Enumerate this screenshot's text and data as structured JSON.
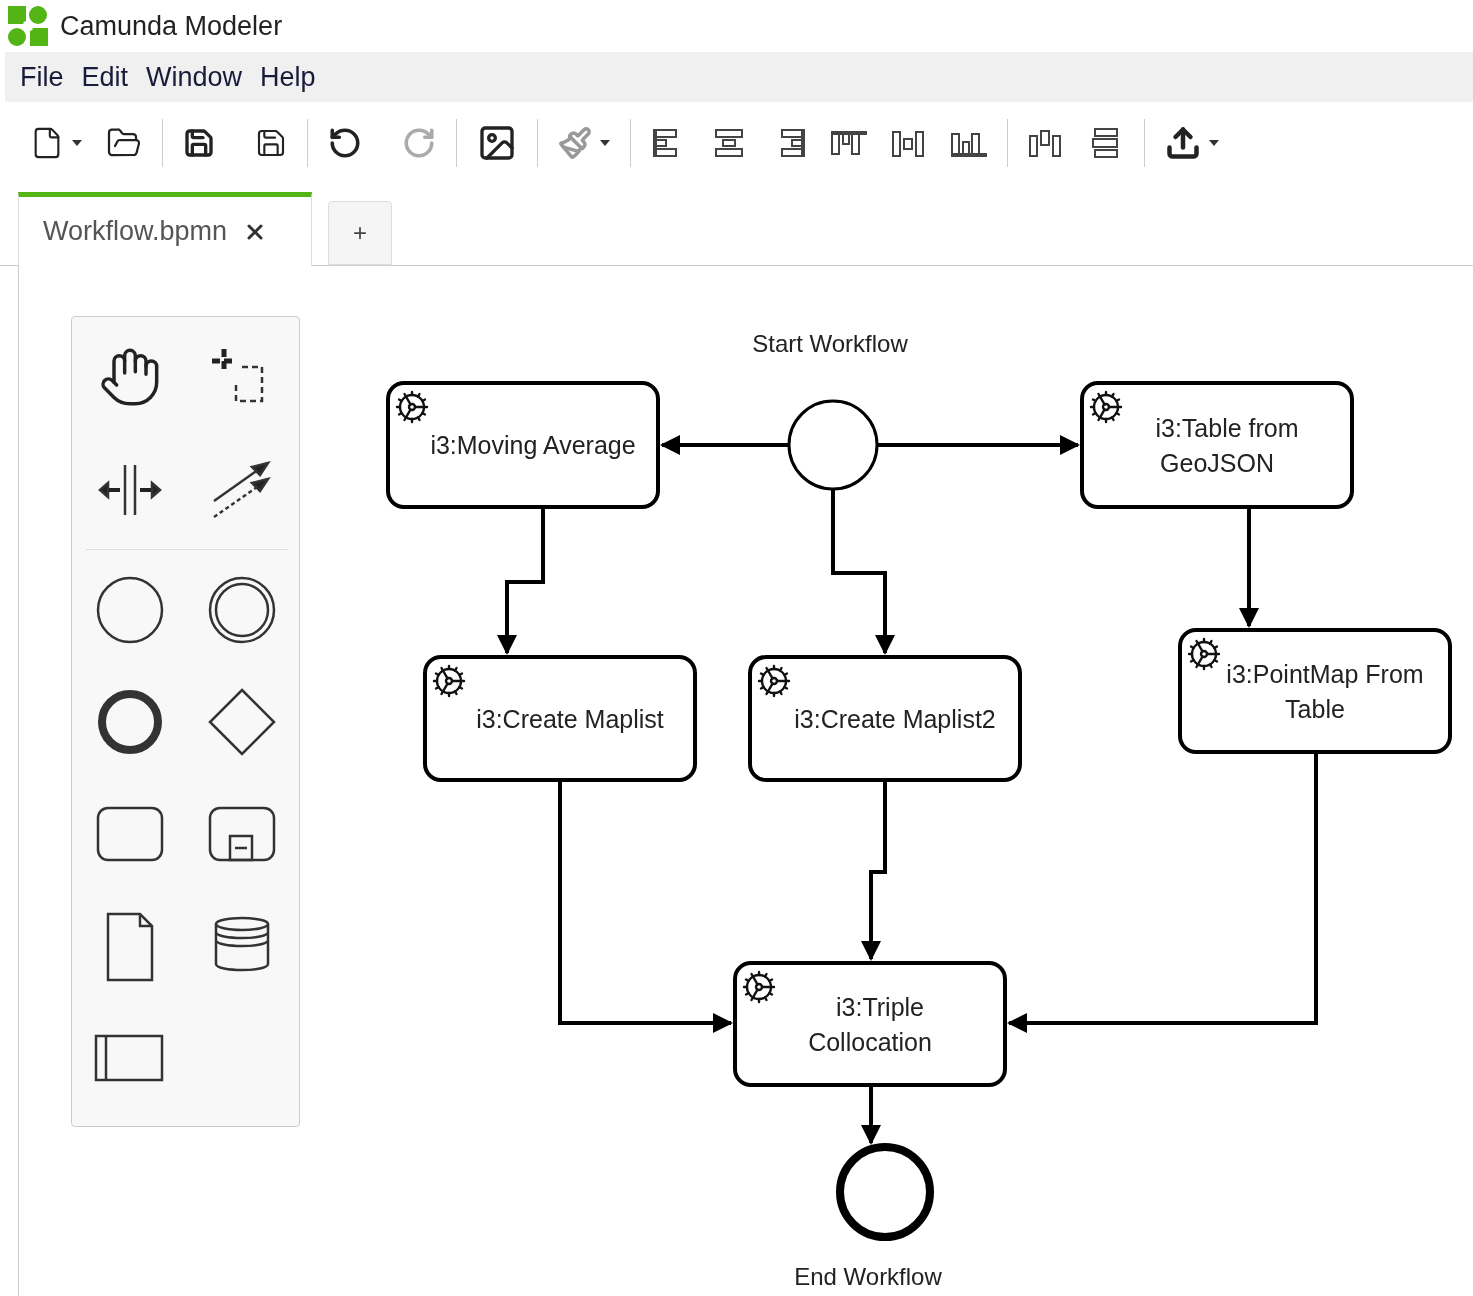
{
  "window": {
    "title": "Camunda Modeler"
  },
  "menu": [
    "File",
    "Edit",
    "Window",
    "Help"
  ],
  "tabs": [
    {
      "label": "Workflow.bpmn",
      "selected": true
    }
  ],
  "new_tab": "+",
  "diagram": {
    "events": [
      {
        "kind": "start",
        "label": "Start Workflow"
      },
      {
        "kind": "end",
        "label": "End Workflow"
      }
    ],
    "tasks": [
      {
        "kind": "service",
        "lines": [
          "i3:Moving Average"
        ]
      },
      {
        "kind": "service",
        "lines": [
          "i3:Table from",
          "GeoJSON"
        ]
      },
      {
        "kind": "service",
        "lines": [
          "i3:Create Maplist"
        ]
      },
      {
        "kind": "service",
        "lines": [
          "i3:Create Maplist2"
        ]
      },
      {
        "kind": "service",
        "lines": [
          "i3:PointMap From",
          "Table"
        ]
      },
      {
        "kind": "service",
        "lines": [
          "i3:Triple",
          "Collocation"
        ]
      }
    ]
  }
}
